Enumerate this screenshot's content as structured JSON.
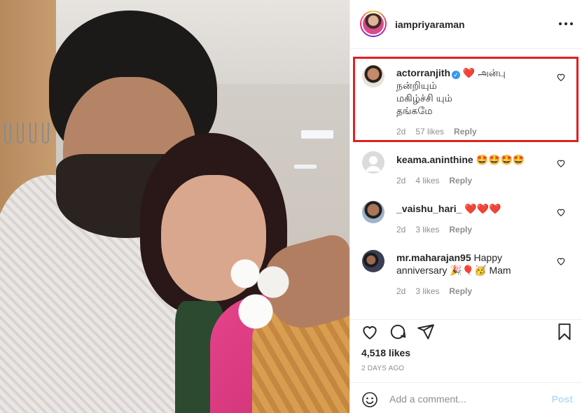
{
  "post": {
    "username": "iampriyaraman",
    "more_icon": "more-horizontal-icon"
  },
  "comments": [
    {
      "username": "actorranjith",
      "verified": true,
      "text_lines": [
        "❤️ அன்பு",
        "நன்றியும்",
        "மகிழ்ச்சி யும்",
        "தங்கமே"
      ],
      "age": "2d",
      "likes": "57 likes",
      "reply": "Reply",
      "highlighted": true
    },
    {
      "username": "keama.aninthine",
      "text_lines": [
        "🤩🤩🤩🤩"
      ],
      "age": "2d",
      "likes": "4 likes",
      "reply": "Reply"
    },
    {
      "username": "_vaishu_hari_",
      "text_lines": [
        "❤️❤️❤️"
      ],
      "age": "2d",
      "likes": "3 likes",
      "reply": "Reply"
    },
    {
      "username": "mr.maharajan95",
      "text_lines": [
        "Happy",
        "anniversary 🎉🎈🥳 Mam"
      ],
      "age": "2d",
      "likes": "3 likes",
      "reply": "Reply"
    }
  ],
  "actions": {
    "like_icon": "heart-outline-icon",
    "comment_icon": "comment-bubble-icon",
    "share_icon": "paper-plane-icon",
    "save_icon": "bookmark-icon",
    "likes_count": "4,518 likes",
    "time_ago": "2 DAYS AGO"
  },
  "add_comment": {
    "emoji_icon": "smiley-icon",
    "placeholder": "Add a comment...",
    "post_label": "Post",
    "post_color": "#b2dffc"
  },
  "colors": {
    "highlight_border": "#e02020",
    "heart_red": "#ed4956",
    "verified_blue": "#3897f0"
  }
}
